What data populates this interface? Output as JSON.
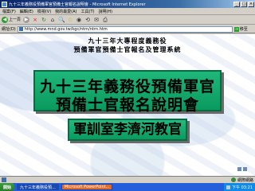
{
  "window": {
    "title": "九十三年義務役預備軍官預備士官報名說明會 - Microsoft Internet Explorer",
    "minimize": "_",
    "maximize": "□",
    "close": "×"
  },
  "menu": [
    "檔案(F)",
    "編輯(E)",
    "檢視(V)",
    "我的最愛(A)",
    "工具(T)",
    "說明(H)"
  ],
  "toolbar": {
    "back_label": "上一頁",
    "stop_icon": "×",
    "refresh_icon": "↻",
    "home_icon": "⌂",
    "search_icon": "🔍",
    "favorites_icon": "☆",
    "media_icon": "◉",
    "history_icon": "⟲",
    "mail_icon": "✉",
    "print_icon": "⎙"
  },
  "address": {
    "label": "網址(D)",
    "value": "http://www.mnd.gov.tw/kgc/ntrn/ntrn.htm",
    "go_label": "移至"
  },
  "slide": {
    "heading_line1": "九十三年大專程度義務役",
    "heading_line2": "預備軍官預備士官報名及管理系統",
    "banner_line1": "九十三年義務役預備軍官",
    "banner_line2": "預備士官報名說明會",
    "presenter": "軍訓室李濟河教官"
  },
  "status": {
    "text": "",
    "zone": "網際網路"
  },
  "taskbar": {
    "start": "開始",
    "tasks": [
      "九十三年義務役預...",
      "Microsoft PowerPoint..."
    ],
    "clock": "下午 03:21"
  },
  "colors": {
    "banner_green": "#1fb77b",
    "titlebar_blue": "#0a246a",
    "taskbar_blue": "#245edb"
  }
}
